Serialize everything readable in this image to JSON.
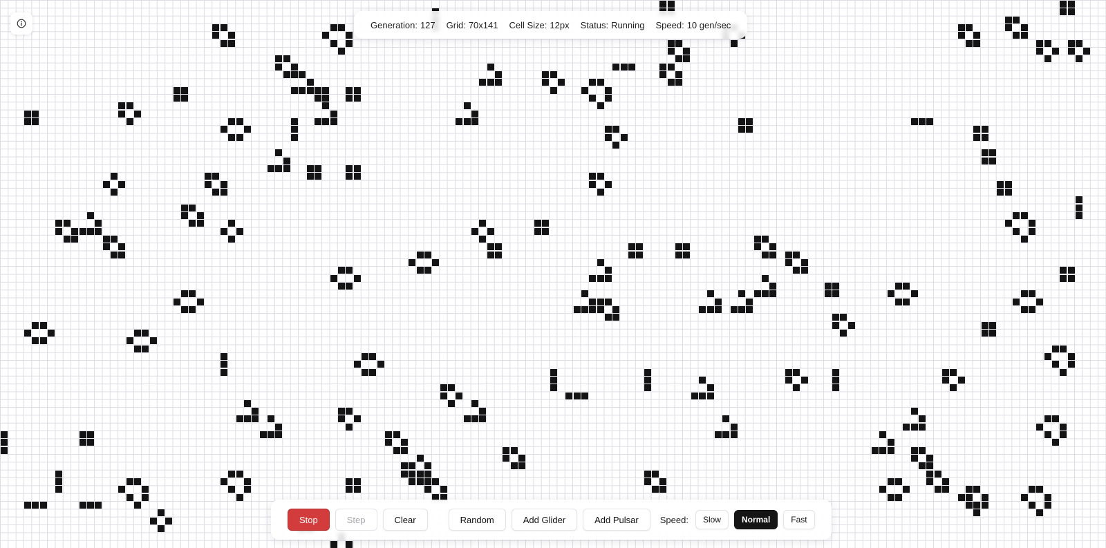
{
  "stats": {
    "generation_label": "Generation:",
    "generation_value": "127",
    "grid_label": "Grid:",
    "grid_value": "70x141",
    "cell_size_label": "Cell Size:",
    "cell_size_value": "12px",
    "status_label": "Status:",
    "status_value": "Running",
    "speed_label": "Speed:",
    "speed_value": "10 gen/sec"
  },
  "toolbar": {
    "stop_label": "Stop",
    "step_label": "Step",
    "clear_label": "Clear",
    "random_label": "Random",
    "add_glider_label": "Add Glider",
    "add_pulsar_label": "Add Pulsar",
    "speed_label": "Speed:",
    "speed_options": [
      "Slow",
      "Normal",
      "Fast"
    ],
    "speed_selected": "Normal"
  },
  "colors": {
    "stop_button": "#d23c3c",
    "live_cell": "#141414",
    "selected_speed": "#151515"
  },
  "icons": {
    "info": "info-icon"
  }
}
